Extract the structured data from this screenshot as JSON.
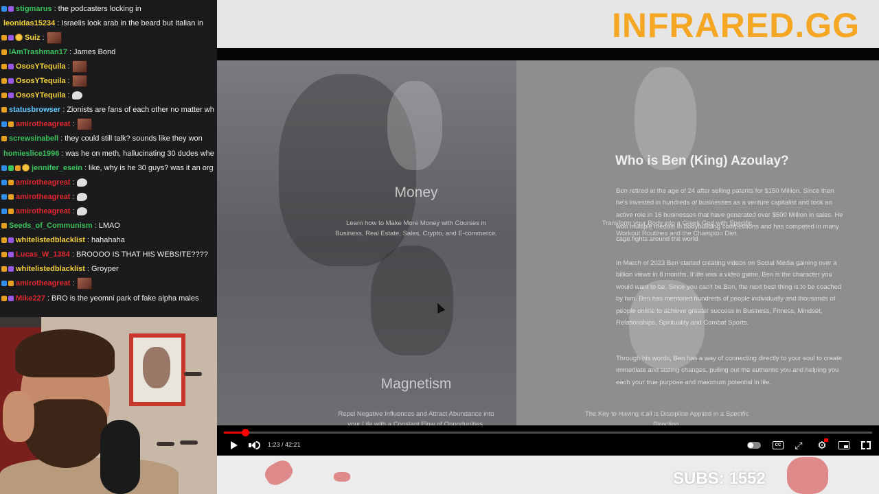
{
  "chat": {
    "messages": [
      {
        "badges": [
          "blue",
          "purple"
        ],
        "user": "stigmarus",
        "color": "#3ac25a",
        "text": "the podcasters locking in",
        "extra": ""
      },
      {
        "badges": [],
        "user": "leonidas15234",
        "color": "#f3d33a",
        "text": "Israelis look arab in the beard but Italian in",
        "extra": ""
      },
      {
        "badges": [
          "orange",
          "purple",
          "coin"
        ],
        "user": "Suiz",
        "color": "#f3d33a",
        "text": "",
        "extra": "emote"
      },
      {
        "badges": [
          "orange"
        ],
        "user": "IAmTrashman17",
        "color": "#3ac25a",
        "text": "James Bond",
        "extra": ""
      },
      {
        "badges": [
          "orange",
          "purple"
        ],
        "user": "OsosYTequila",
        "color": "#f3d33a",
        "text": "",
        "extra": "emote"
      },
      {
        "badges": [
          "orange",
          "purple"
        ],
        "user": "OsosYTequila",
        "color": "#f3d33a",
        "text": "",
        "extra": "emote"
      },
      {
        "badges": [
          "orange",
          "purple"
        ],
        "user": "OsosYTequila",
        "color": "#f3d33a",
        "text": "",
        "extra": "bubble"
      },
      {
        "badges": [
          "orange"
        ],
        "user": "statusbrowser",
        "color": "#5fc8ff",
        "text": "Zionists are fans of each other no matter wh",
        "extra": ""
      },
      {
        "badges": [
          "blue",
          "orange"
        ],
        "user": "amirotheagreat",
        "color": "#e0262e",
        "text": "",
        "extra": "emote"
      },
      {
        "badges": [
          "orange"
        ],
        "user": "screwsinabell",
        "color": "#3ac25a",
        "text": "they could still talk? sounds like they won",
        "extra": ""
      },
      {
        "badges": [],
        "user": "homieslice1996",
        "color": "#3ac25a",
        "text": "was he on meth, hallucinating 30 dudes whe",
        "extra": ""
      },
      {
        "badges": [
          "blue",
          "green",
          "orange",
          "coin"
        ],
        "user": "jennifer_esein",
        "color": "#3ac25a",
        "text": "like, why is he 30 guys? was it an org",
        "extra": ""
      },
      {
        "badges": [
          "blue",
          "orange"
        ],
        "user": "amirotheagreat",
        "color": "#e0262e",
        "text": "",
        "extra": "bubble"
      },
      {
        "badges": [
          "blue",
          "orange"
        ],
        "user": "amirotheagreat",
        "color": "#e0262e",
        "text": "",
        "extra": "bubble"
      },
      {
        "badges": [
          "blue",
          "orange"
        ],
        "user": "amirotheagreat",
        "color": "#e0262e",
        "text": "",
        "extra": "bubble"
      },
      {
        "badges": [
          "orange"
        ],
        "user": "Seeds_of_Communism",
        "color": "#3ac25a",
        "text": "LMAO",
        "extra": ""
      },
      {
        "badges": [
          "orange",
          "purple"
        ],
        "user": "whitelistedblacklist",
        "color": "#f3d33a",
        "text": "hahahaha",
        "extra": ""
      },
      {
        "badges": [
          "orange",
          "purple"
        ],
        "user": "Lucas_W_1384",
        "color": "#e0262e",
        "text": "BROOOO IS THAT HIS WEBSITE????",
        "extra": ""
      },
      {
        "badges": [
          "orange",
          "purple"
        ],
        "user": "whitelistedblacklist",
        "color": "#f3d33a",
        "text": "Groyper",
        "extra": ""
      },
      {
        "badges": [
          "blue",
          "orange"
        ],
        "user": "amirotheagreat",
        "color": "#e0262e",
        "text": "",
        "extra": "emote"
      },
      {
        "badges": [
          "orange",
          "purple"
        ],
        "user": "Mike227",
        "color": "#e0262e",
        "text": "BRO is the yeomni park of fake alpha males",
        "extra": ""
      }
    ]
  },
  "stream": {
    "brand": "INFRARED.GG",
    "subs_label": "SUBS: 1552"
  },
  "video": {
    "money_title": "Money",
    "money_desc_1": "Learn how to Make More Money with Courses in",
    "money_desc_2": "Business, Real Estate, Sales, Crypto, and E-commerce.",
    "fitness_desc_1": "Transform your Body into a Greek God with Specific",
    "fitness_desc_2": "Workout Routines and the Champion Diet.",
    "magnetism_title": "Magnetism",
    "magnetism_desc_1": "Repel Negative Influences and Attract Abundance into",
    "magnetism_desc_2": "your Life with a Constant Flow of Opportunities.",
    "discipline_desc_1": "The Key to Having it all is Discipline Applied in a Specific",
    "discipline_desc_2": "Direction.",
    "heading": "Who is Ben (King) Azoulay?",
    "bio_p1": "Ben retired at the age of 24 after selling patents for $150 Million. Since then he's invested in hundreds of businesses as a venture capitalist and took an active role in 16 businesses that have generated over $500 Million in sales. He won multiple medals in bodybuilding competitions and has competed in many cage fights around the world.",
    "bio_p2": "In March of 2023 Ben started creating videos on Social Media gaining over a billion views in 8 months. If life was a video game, Ben is the character you would want to be. Since you can't be Ben, the next best thing is to be coached by him. Ben has mentored hundreds of people individually and thousands of people online to achieve greater success in Business, Fitness, Mindset, Relationships, Spirituality and Combat Sports.",
    "bio_p3": "Through his words, Ben has a way of connecting directly to your soul to create immediate and lasting changes, pulling out the authentic you and helping you each your true purpose and maximum potential in life."
  },
  "player": {
    "time": "1:23 / 42:21",
    "progress": 0.033,
    "icons": [
      "play-icon",
      "volume-icon",
      "autoplay-toggle-icon",
      "captions-icon",
      "share-icon",
      "settings-icon",
      "miniplayer-icon",
      "fullscreen-icon"
    ]
  }
}
